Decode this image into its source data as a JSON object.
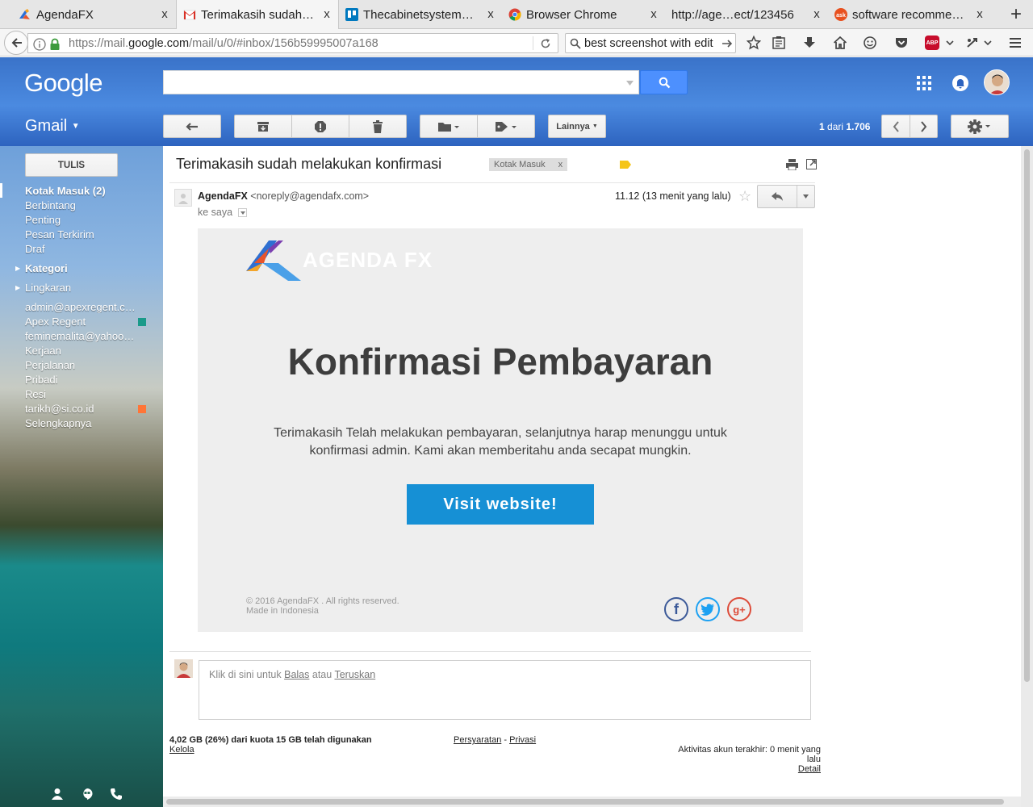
{
  "browser": {
    "tabs": [
      {
        "title": "AgendaFX",
        "icon": "agendafx-icon",
        "active": false
      },
      {
        "title": "Terimakasih sudah…",
        "icon": "gmail-icon",
        "active": true
      },
      {
        "title": "Thecabinetsystem…",
        "icon": "trello-icon",
        "active": false
      },
      {
        "title": "Browser Chrome",
        "icon": "chrome-icon",
        "active": false
      },
      {
        "title": "http://age…ect/123456",
        "icon": "",
        "active": false
      },
      {
        "title": "software recomme…",
        "icon": "ask-icon",
        "active": false
      }
    ],
    "close_glyph": "x",
    "newtab_glyph": "+",
    "url_prefix": "https://mail.",
    "url_domain": "google.com",
    "url_path": "/mail/u/0/#inbox/156b59995007a168",
    "search_value": "best screenshot with edit",
    "adblock_label": "ABP"
  },
  "gmail": {
    "logo": "Google",
    "app_label": "Gmail",
    "more_button": "Lainnya",
    "pager_from": "1",
    "pager_of": "dari",
    "pager_total": "1.706",
    "compose": "TULIS",
    "nav": [
      {
        "label": "Kotak Masuk (2)",
        "bold": true
      },
      {
        "label": "Berbintang",
        "bold": false
      },
      {
        "label": "Penting",
        "bold": false
      },
      {
        "label": "Pesan Terkirim",
        "bold": false
      },
      {
        "label": "Draf",
        "bold": false
      }
    ],
    "categories": "Kategori",
    "circles": "Lingkaran",
    "labels": [
      "admin@apexregent.c…",
      "Apex Regent",
      "feminemalita@yahoo…",
      "Kerjaan",
      "Perjalanan",
      "Pribadi",
      "Resi",
      "tarikh@si.co.id",
      "Selengkapnya"
    ],
    "colors": {
      "accent": "#4d90fe",
      "button_blue": "#1690d5",
      "label_teal": "#16a765",
      "label_orange": "#ff7537"
    }
  },
  "message": {
    "subject": "Terimakasih sudah melakukan konfirmasi",
    "chip": "Kotak Masuk",
    "chip_close": "x",
    "sender_name": "AgendaFX",
    "sender_email": "<noreply@agendafx.com>",
    "recipient": "ke saya",
    "time": "11.12 (13 menit yang lalu)",
    "email": {
      "brand": "AGENDA FX",
      "title": "Konfirmasi Pembayaran",
      "text": "Terimakasih Telah melakukan pembayaran, selanjutnya harap menunggu untuk konfirmasi admin. Kami akan memberitahu anda secapat mungkin.",
      "button": "Visit website!",
      "copyright": "© 2016 AgendaFX . All rights reserved.",
      "made_in": "Made in Indonesia"
    },
    "reply_prefix": "Klik di sini untuk",
    "reply_link": "Balas",
    "reply_mid": "atau",
    "forward_link": "Teruskan"
  },
  "footer": {
    "quota": "4,02 GB (26%) dari kuota 15 GB telah digunakan",
    "manage": "Kelola",
    "terms": "Persyaratan",
    "sep": "-",
    "privacy": "Privasi",
    "activity": "Aktivitas akun terakhir: 0 menit yang lalu",
    "detail": "Detail"
  }
}
